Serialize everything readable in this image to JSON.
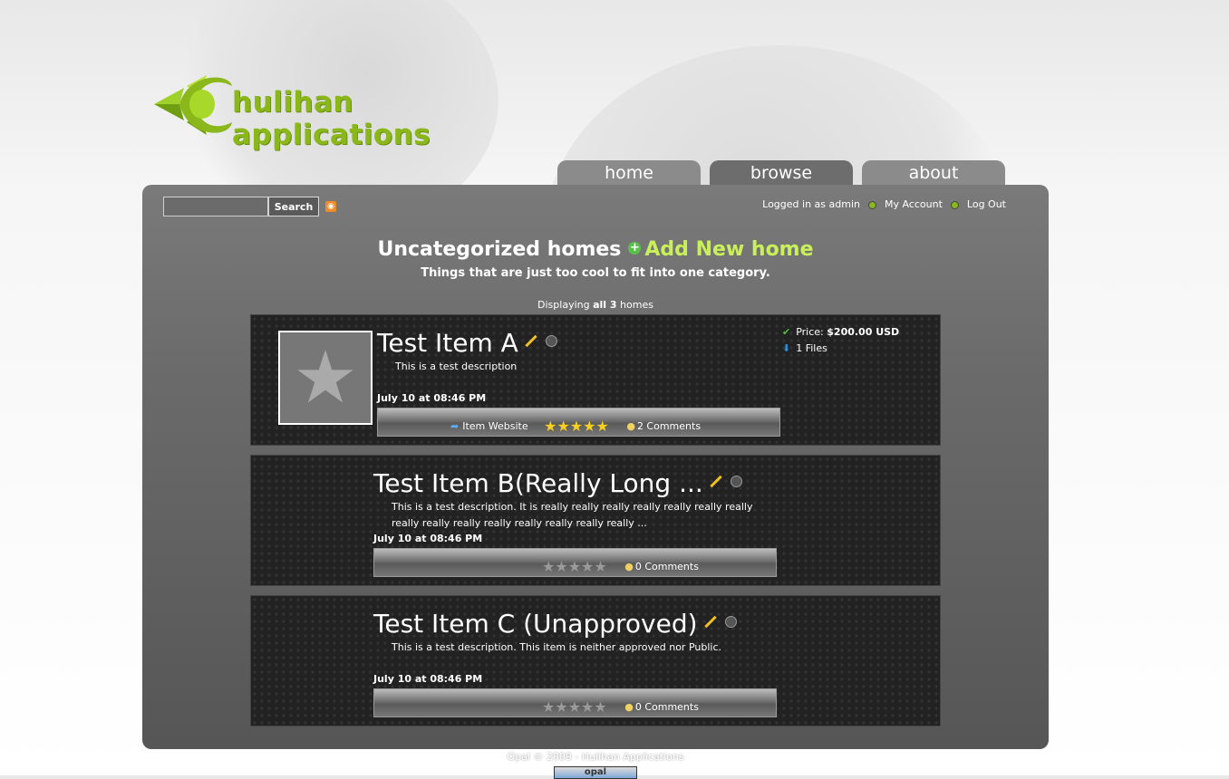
{
  "brand": {
    "name": "hulihan applications"
  },
  "nav": {
    "tabs": [
      {
        "label": "home"
      },
      {
        "label": "browse"
      },
      {
        "label": "about"
      }
    ],
    "active": "browse"
  },
  "search": {
    "value": "",
    "button_label": "Search"
  },
  "user": {
    "logged_in_text": "Logged in as admin",
    "my_account": "My Account",
    "log_out": "Log Out"
  },
  "page": {
    "title": "Uncategorized homes",
    "add_new": "Add New home",
    "subtitle": "Things that are just too cool to fit into one category.",
    "displaying_prefix": "Displaying",
    "displaying_count": "all 3",
    "displaying_suffix": "homes"
  },
  "items": [
    {
      "title": "Test Item A",
      "description": "This is a test description",
      "date": "July 10 at 08:46 PM",
      "website_label": "Item Website",
      "rating": 5,
      "comments": "2 Comments",
      "price_label": "Price:",
      "price_value": "$200.00 USD",
      "files": "1 Files"
    },
    {
      "title": "Test Item B(Really Long ...",
      "description": "This is a test description. It is really really really really really really really really really really really really really really really ...",
      "date": "July 10 at 08:46 PM",
      "rating": 0,
      "comments": "0 Comments"
    },
    {
      "title": "Test Item C (Unapproved)",
      "description": "This is a test description. This item is neither approved nor Public.",
      "date": "July 10 at 08:46 PM",
      "rating": 0,
      "comments": "0 Comments"
    }
  ],
  "footer": {
    "text": "Opal © 2009 - Hulihan Applications",
    "badge": "opal"
  },
  "colors": {
    "accent": "#c9f05a",
    "brand_green": "#8ab81a",
    "panel": "#6a6a6a"
  }
}
